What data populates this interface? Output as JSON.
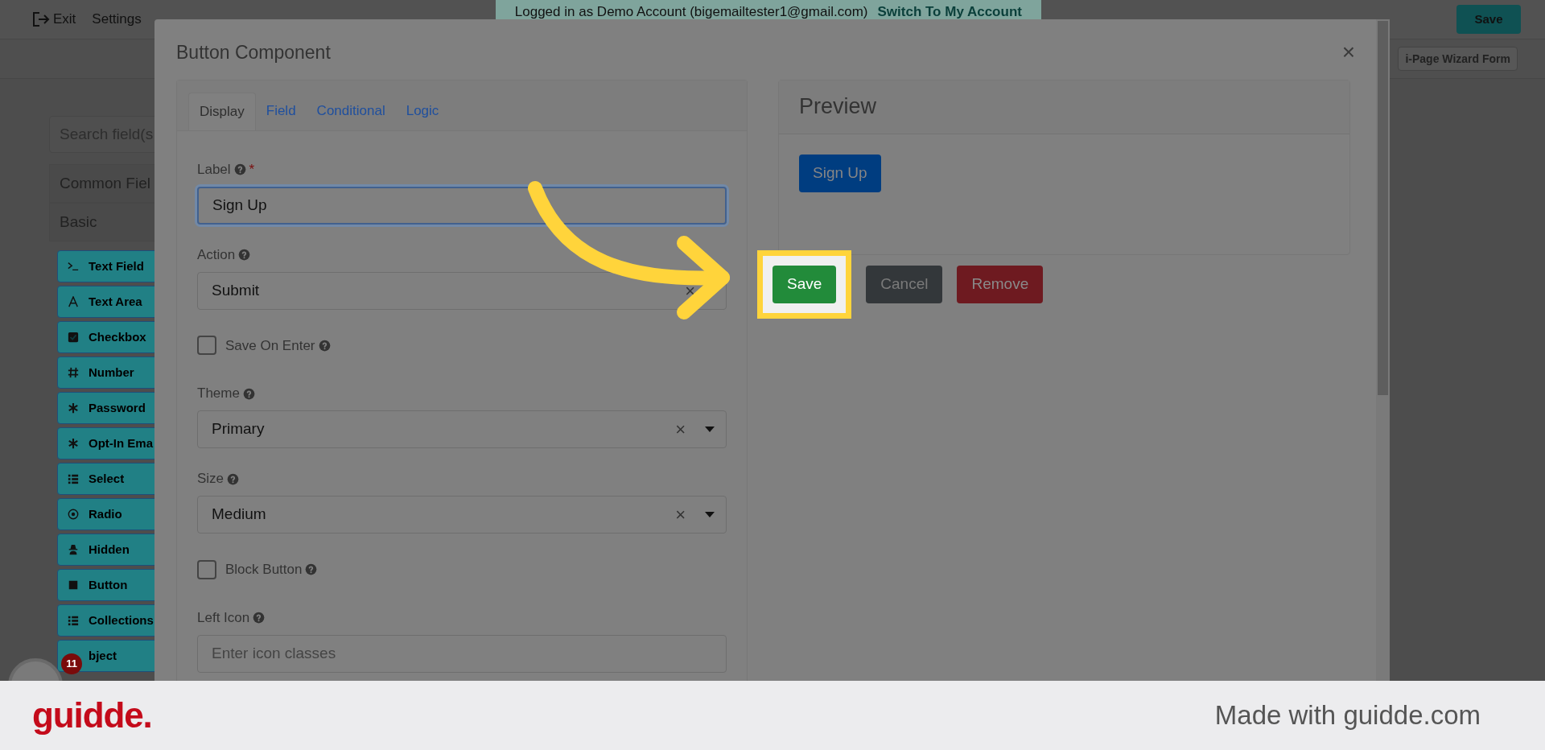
{
  "top_bar": {
    "links": [
      {
        "label": "Exit"
      },
      {
        "label": "Settings"
      }
    ],
    "banner": {
      "text": "Logged in as Demo Account (bigemailtester1@gmail.com)",
      "link": "Switch To My Account"
    },
    "save_button": "Save"
  },
  "sub_bar": {
    "button": "i-Page Wizard Form"
  },
  "sidebar": {
    "search_placeholder": "Search field(s",
    "groups": [
      "Common Fiel",
      "Basic"
    ],
    "components": [
      "Text Field",
      "Text Area",
      "Checkbox",
      "Number",
      "Password",
      "Opt-In Ema",
      "Select",
      "Radio",
      "Hidden",
      "Button",
      "Collections",
      "bject"
    ]
  },
  "modal": {
    "title": "Button Component",
    "close": "×",
    "tabs": [
      {
        "label": "Display",
        "selected": true
      },
      {
        "label": "Field",
        "selected": false
      },
      {
        "label": "Conditional",
        "selected": false
      },
      {
        "label": "Logic",
        "selected": false
      }
    ],
    "fields": [
      {
        "kind": "text",
        "label": "Label",
        "required_mark": "*",
        "value": "Sign Up",
        "focused": true
      },
      {
        "kind": "select",
        "label": "Action",
        "value": "Submit",
        "clear": "×"
      },
      {
        "kind": "checkbox",
        "label": "Save On Enter",
        "checked": false
      },
      {
        "kind": "select",
        "label": "Theme",
        "value": "Primary",
        "clear": "×"
      },
      {
        "kind": "select",
        "label": "Size",
        "value": "Medium",
        "clear": "×"
      },
      {
        "kind": "checkbox",
        "label": "Block Button",
        "checked": false
      },
      {
        "kind": "text",
        "label": "Left Icon",
        "placeholder": "Enter icon classes",
        "focused": false
      }
    ],
    "preview": {
      "title": "Preview",
      "button": "Sign Up"
    },
    "actions": [
      {
        "label": "Save",
        "kind": "success",
        "highlighted": true
      },
      {
        "label": "Cancel",
        "kind": "secondary",
        "highlighted": false
      },
      {
        "label": "Remove",
        "kind": "danger",
        "highlighted": false
      }
    ]
  },
  "avatar": {
    "badge": "11"
  },
  "footer": {
    "logo": "guidde.",
    "credit": "Made with guidde.com"
  }
}
